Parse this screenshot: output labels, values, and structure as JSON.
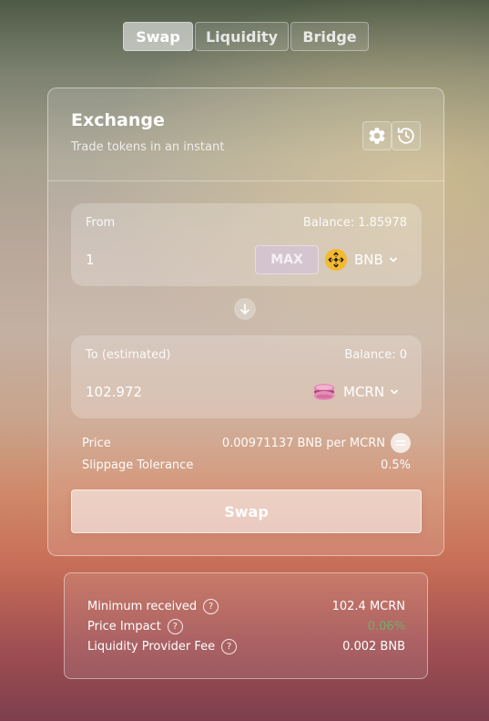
{
  "tabs": [
    {
      "label": "Swap",
      "active": true
    },
    {
      "label": "Liquidity",
      "active": false
    },
    {
      "label": "Bridge",
      "active": false
    }
  ],
  "exchange": {
    "title": "Exchange",
    "subtitle": "Trade tokens in an instant",
    "icons": [
      "gear-icon",
      "history-icon"
    ]
  },
  "from": {
    "label": "From",
    "balance": "Balance: 1.85978",
    "amount": "1",
    "max_label": "MAX",
    "token": "BNB",
    "token_icon": "bnb-logo-icon"
  },
  "to": {
    "label": "To (estimated)",
    "balance": "Balance: 0",
    "amount": "102.972",
    "token": "MCRN",
    "token_icon": "macaron-logo-icon"
  },
  "price": {
    "label": "Price",
    "value": "0.00971137 BNB per MCRN"
  },
  "slippage": {
    "label": "Slippage Tolerance",
    "value": "0.5%"
  },
  "swap_button": "Swap",
  "details": {
    "minimum_received": {
      "label": "Minimum received",
      "value": "102.4 MCRN"
    },
    "price_impact": {
      "label": "Price Impact",
      "value": "0.06%",
      "color": "#6fae6a"
    },
    "lp_fee": {
      "label": "Liquidity Provider Fee",
      "value": "0.002 BNB"
    },
    "help_glyph": "?"
  },
  "colors": {
    "bnb": "#f3ba2f",
    "macaron": "#e58fb6"
  }
}
